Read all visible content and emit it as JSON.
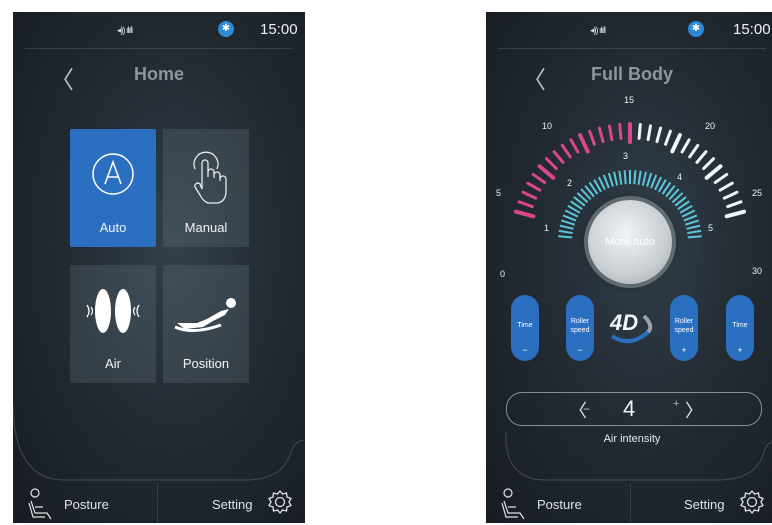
{
  "status_bar": {
    "signal": "◂)) ılıll",
    "bluetooth": "✱",
    "time": "15:00"
  },
  "home": {
    "back": "〈",
    "title": "Home",
    "tiles": [
      {
        "label": "Auto",
        "icon": "auto-a-icon"
      },
      {
        "label": "Manual",
        "icon": "hand-touch-icon"
      },
      {
        "label": "Air",
        "icon": "air-pads-icon"
      },
      {
        "label": "Position",
        "icon": "recline-icon"
      }
    ]
  },
  "full_body": {
    "back": "〈",
    "title": "Full Body",
    "outer_scale": [
      "0",
      "5",
      "10",
      "15",
      "20",
      "25",
      "30"
    ],
    "inner_scale": [
      "1",
      "2",
      "3",
      "4",
      "5"
    ],
    "center_button": "More auto",
    "controls": [
      {
        "label": "Time",
        "sign": "−"
      },
      {
        "label": "Roller speed",
        "sign": "−"
      },
      {
        "label": "Roller speed",
        "sign": "+"
      },
      {
        "label": "Time",
        "sign": "+"
      }
    ],
    "logo_4d": "4D",
    "air_intensity": {
      "left": "〈",
      "minus": "−",
      "value": "4",
      "plus": "+",
      "right": "〉",
      "label": "Air intensity"
    }
  },
  "nav": {
    "posture": "Posture",
    "setting": "Setting"
  },
  "colors": {
    "accent_blue": "#2a6fc0",
    "pink": "#d9478f",
    "cyan": "#5cc7dc",
    "bluetooth": "#2d8bd6"
  }
}
